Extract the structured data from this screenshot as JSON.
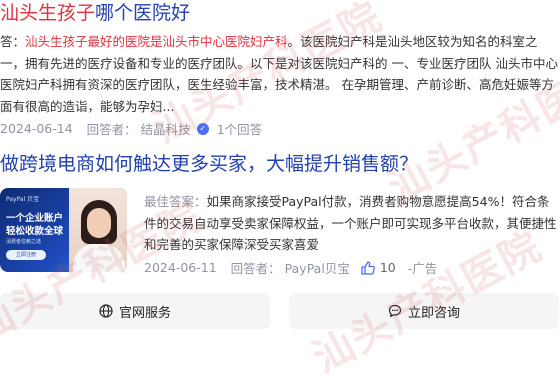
{
  "result1": {
    "title_highlight": "汕头生孩子",
    "title_rest": "哪个医院好",
    "answer_prefix": "答：",
    "answer_highlight": "汕头生孩子最好的医院是汕头市中心医院妇产科",
    "answer_rest": "。该医院妇产科是汕头地区较为知名的科室之一，拥有先进的医疗设备和专业的医疗团队。以下是对该医院妇产科的 一、专业医疗团队 汕头市中心医院妇产科拥有资深的医疗团队，医生经验丰富，技术精湛。 在孕期管理、产前诊断、高危妊娠等方面有很高的造诣，能够为孕妇...",
    "date": "2024-06-14",
    "answerer_label": "回答者：",
    "answerer": "结晶科技",
    "answer_count": "1个回答"
  },
  "result2": {
    "title": "做跨境电商如何触达更多买家，大幅提升销售额？",
    "thumb": {
      "brand": "PayPal 贝宝",
      "line1": "一个企业账户",
      "line2": "轻松收款全球",
      "sub": "消费者信赖之选",
      "cta": "立即注册"
    },
    "answer_prefix": "最佳答案：",
    "answer_text": "如果商家接受PayPal付款，消费者购物意愿提高54%！符合条件的交易自动享受卖家保障权益，一个账户即可实现多平台收款，其便捷性和完善的买家保障深受买家喜爱",
    "date": "2024-06-11",
    "answerer_label": "回答者：",
    "answerer": "PayPal贝宝",
    "likes": "10",
    "ad_label": "-广告"
  },
  "buttons": {
    "official": "官网服务",
    "consult": "立即咨询"
  },
  "watermark": "汕头产科医院",
  "colors": {
    "link": "#2440b3",
    "highlight": "#e3313f",
    "meta": "#9195a3",
    "brand_blue": "#4e6ef2",
    "button_bg": "#f5f5f6"
  }
}
